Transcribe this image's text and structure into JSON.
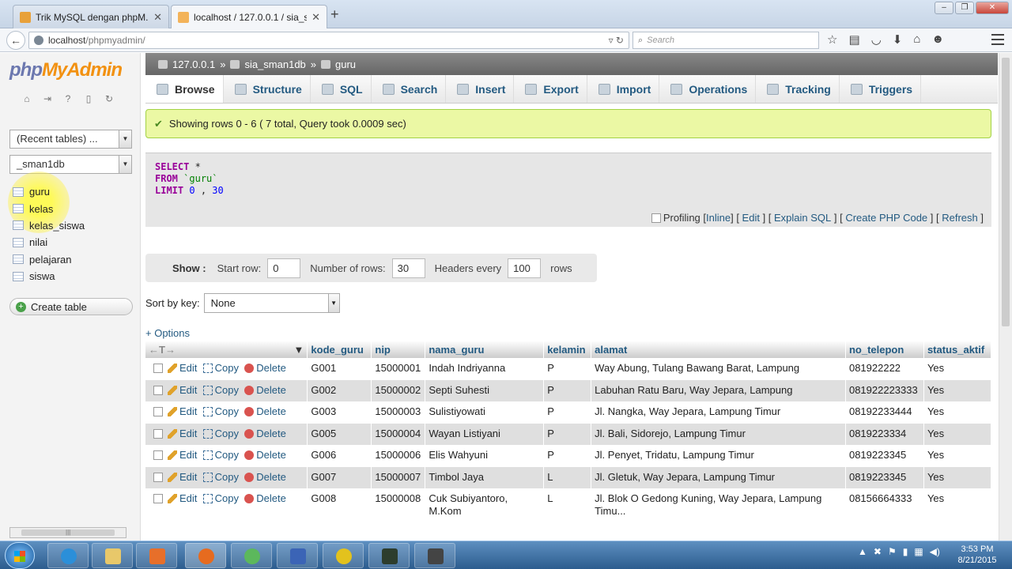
{
  "browser": {
    "tabs": [
      {
        "title": "Trik MySQL dengan phpM...",
        "active": false
      },
      {
        "title": "localhost / 127.0.0.1 / sia_s...",
        "active": true
      }
    ],
    "url_host": "localhost",
    "url_path": "/phpmyadmin/",
    "search_placeholder": "Search"
  },
  "sidebar": {
    "recent_tables": "(Recent tables) ...",
    "database": "_sman1db",
    "tables": [
      "guru",
      "kelas",
      "kelas_siswa",
      "nilai",
      "pelajaran",
      "siswa"
    ],
    "create_table": "Create table"
  },
  "breadcrumb": {
    "server": "127.0.0.1",
    "database": "sia_sman1db",
    "table": "guru"
  },
  "tabs": [
    "Browse",
    "Structure",
    "SQL",
    "Search",
    "Insert",
    "Export",
    "Import",
    "Operations",
    "Tracking",
    "Triggers"
  ],
  "message": "Showing rows 0 - 6 ( 7 total, Query took 0.0009 sec)",
  "sql": {
    "select": "SELECT",
    "star": "*",
    "from": "FROM",
    "table": "`guru`",
    "limit": "LIMIT",
    "offset": "0",
    "comma": ",",
    "count": "30"
  },
  "sql_actions": {
    "profiling": "Profiling",
    "inline": "Inline",
    "edit": "Edit",
    "explain": "Explain SQL",
    "php": "Create PHP Code",
    "refresh": "Refresh"
  },
  "show": {
    "label": "Show :",
    "start_row_label": "Start row:",
    "start_row": "0",
    "rows_label": "Number of rows:",
    "rows": "30",
    "headers_label": "Headers every",
    "headers": "100",
    "rows_suffix": "rows"
  },
  "sort": {
    "label": "Sort by key:",
    "value": "None"
  },
  "options_label": "+ Options",
  "actions": {
    "edit": "Edit",
    "copy": "Copy",
    "delete": "Delete"
  },
  "columns": [
    "kode_guru",
    "nip",
    "nama_guru",
    "kelamin",
    "alamat",
    "no_telepon",
    "status_aktif"
  ],
  "rows": [
    [
      "G001",
      "15000001",
      "Indah Indriyanna",
      "P",
      "Way Abung, Tulang Bawang Barat, Lampung",
      "081922222",
      "Yes"
    ],
    [
      "G002",
      "15000002",
      "Septi Suhesti",
      "P",
      "Labuhan Ratu Baru, Way Jepara, Lampung",
      "081922223333",
      "Yes"
    ],
    [
      "G003",
      "15000003",
      "Sulistiyowati",
      "P",
      "Jl. Nangka, Way Jepara, Lampung Timur",
      "08192233444",
      "Yes"
    ],
    [
      "G005",
      "15000004",
      "Wayan Listiyani",
      "P",
      "Jl. Bali, Sidorejo, Lampung Timur",
      "0819223334",
      "Yes"
    ],
    [
      "G006",
      "15000006",
      "Elis Wahyuni",
      "P",
      "Jl. Penyet, Tridatu, Lampung Timur",
      "0819223345",
      "Yes"
    ],
    [
      "G007",
      "15000007",
      "Timbol Jaya",
      "L",
      "Jl. Gletuk, Way Jepara, Lampung Timur",
      "0819223345",
      "Yes"
    ],
    [
      "G008",
      "15000008",
      "Cuk Subiyantoro, M.Kom",
      "L",
      "Jl. Blok O Gedong Kuning, Way Jepara, Lampung Timu...",
      "08156664333",
      "Yes"
    ]
  ],
  "taskbar": {
    "time": "3:53 PM",
    "date": "8/21/2015"
  }
}
